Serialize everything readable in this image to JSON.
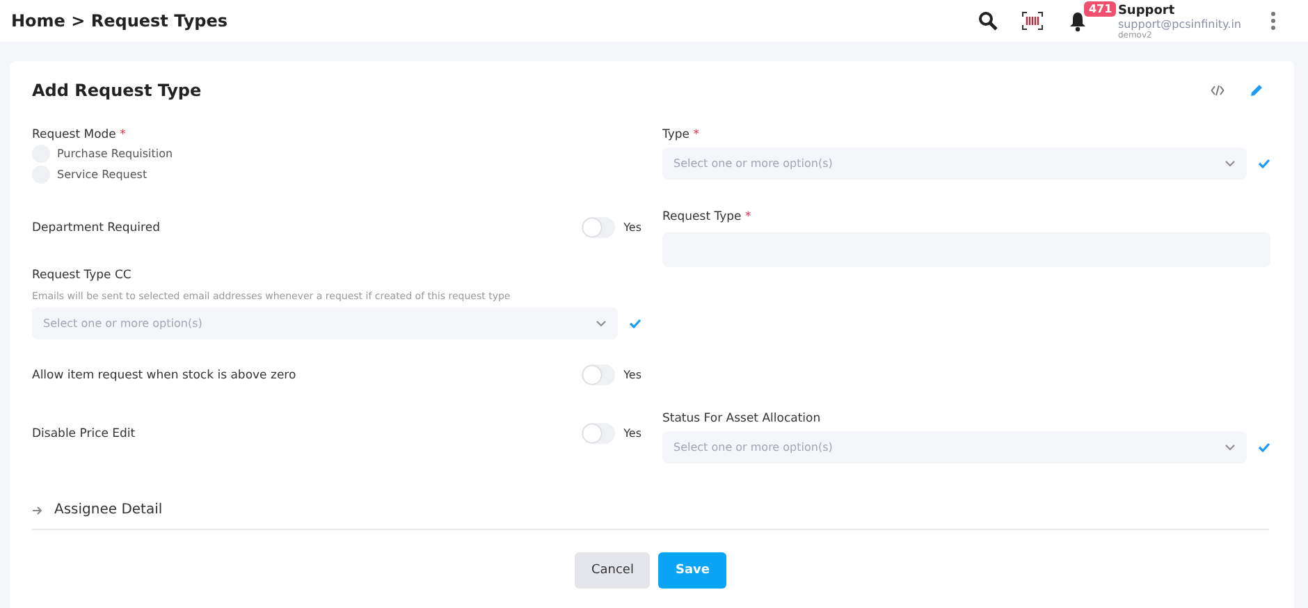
{
  "breadcrumb": {
    "home": "Home",
    "separator": ">",
    "current": "Request Types"
  },
  "user": {
    "badge": "471",
    "name": "Support",
    "email": "support@pcsinfinity.in",
    "tenant": "demov2"
  },
  "card": {
    "title": "Add Request Type"
  },
  "request_mode": {
    "label": "Request Mode",
    "required_mark": "*",
    "options": [
      {
        "label": "Purchase Requisition",
        "selected": false
      },
      {
        "label": "Service Request",
        "selected": false
      }
    ]
  },
  "department_required": {
    "label": "Department Required",
    "on": false,
    "toggle_label": "Yes"
  },
  "request_type_cc": {
    "label": "Request Type CC",
    "hint": "Emails will be sent to selected email addresses whenever a request if created of this request type",
    "placeholder": "Select one or more option(s)"
  },
  "allow_item_request": {
    "label": "Allow item request when stock is above zero",
    "on": false,
    "toggle_label": "Yes"
  },
  "disable_price_edit": {
    "label": "Disable Price Edit",
    "on": false,
    "toggle_label": "Yes"
  },
  "type": {
    "label": "Type",
    "required_mark": "*",
    "placeholder": "Select one or more option(s)"
  },
  "request_type": {
    "label": "Request Type",
    "required_mark": "*"
  },
  "status_for_asset_allocation": {
    "label": "Status For Asset Allocation",
    "placeholder": "Select one or more option(s)"
  },
  "section": {
    "label": "Assignee Detail",
    "expanded": false
  },
  "buttons": {
    "cancel": "Cancel",
    "save": "Save"
  }
}
